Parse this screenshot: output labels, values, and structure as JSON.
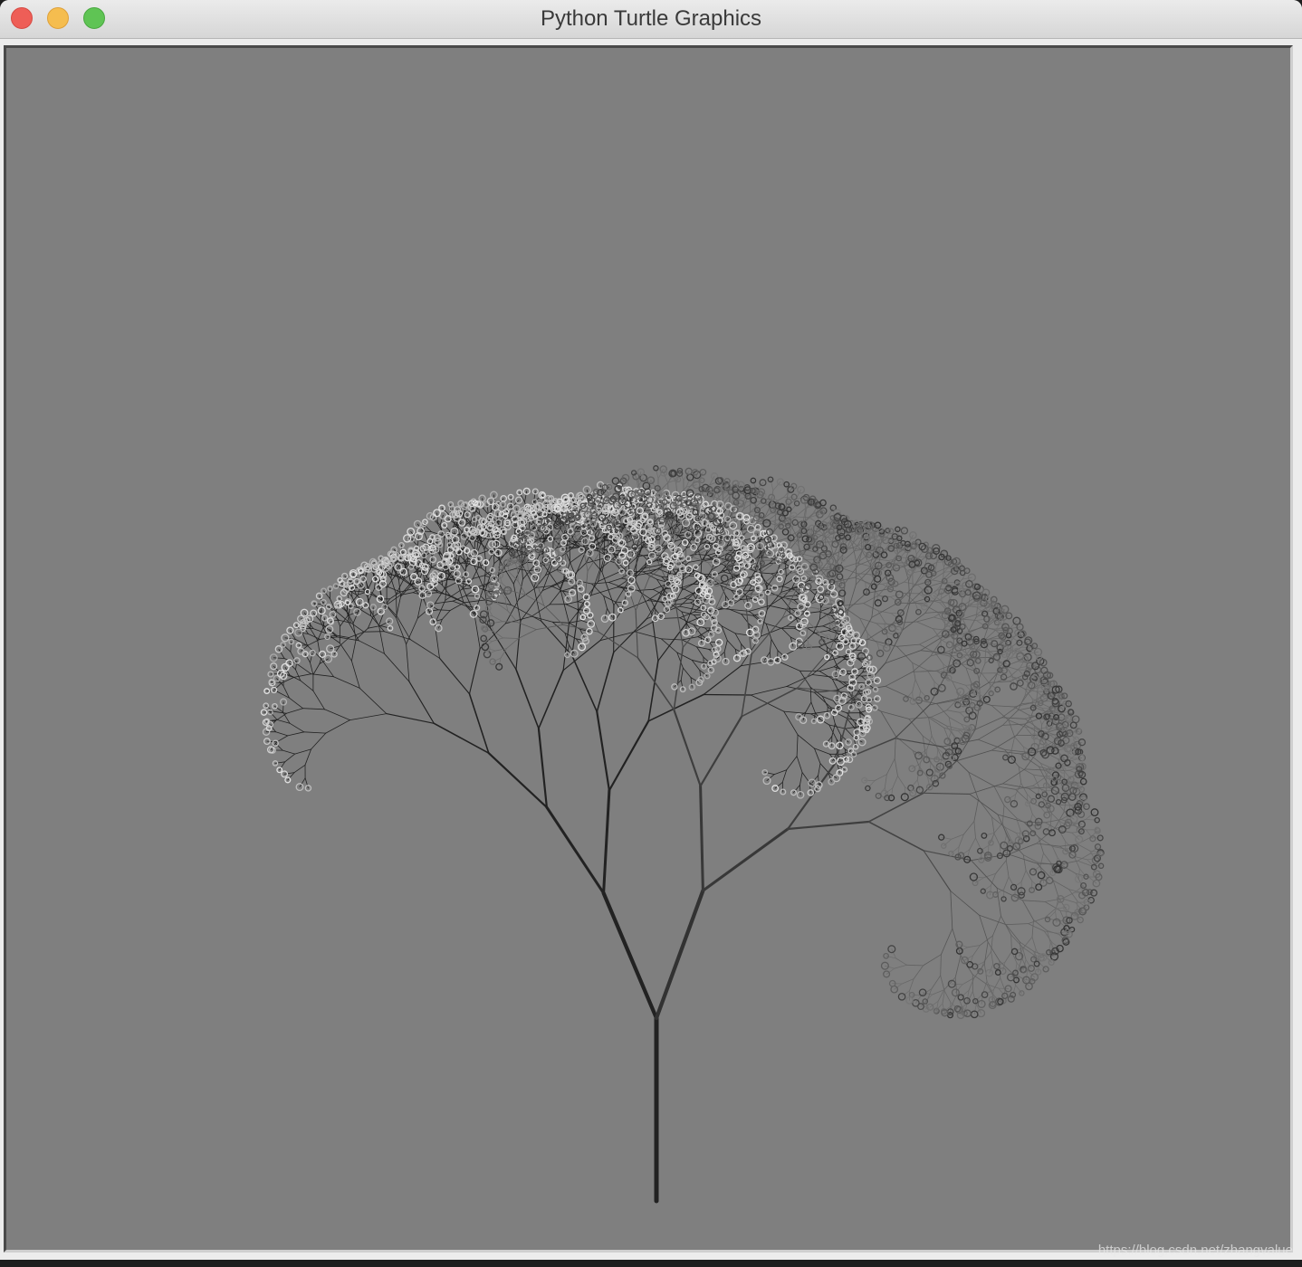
{
  "window": {
    "title": "Python Turtle Graphics"
  },
  "controls": {
    "close": "close-button",
    "minimize": "minimize-button",
    "zoom": "zoom-button"
  },
  "canvas": {
    "background_color": "#7f7f7f",
    "drawing": "fractal-tree",
    "trunk_color": "#222222",
    "leaf_color_light": "#d4d4d4",
    "leaf_color_dark": "#3a3a3a"
  },
  "watermark": "https://blog.csdn.net/zhangvalue"
}
